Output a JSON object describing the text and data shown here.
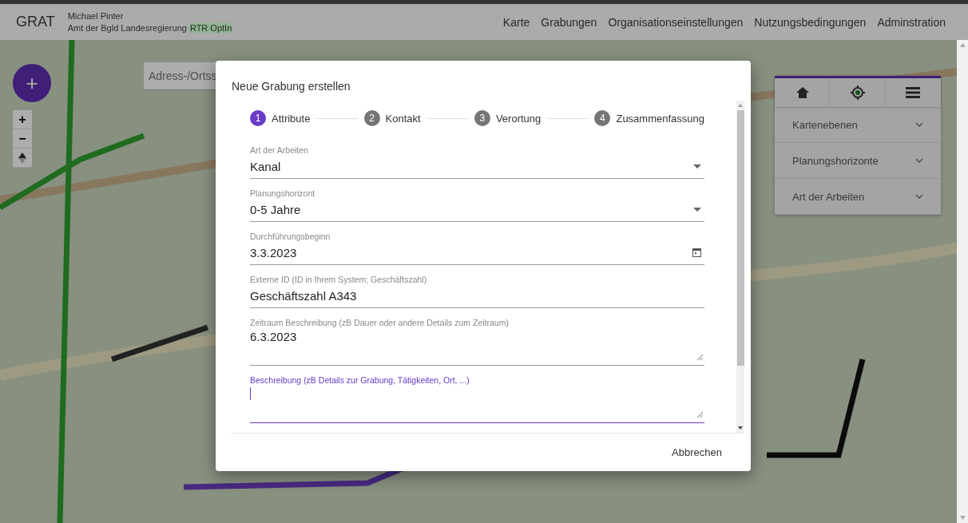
{
  "header": {
    "app_name": "GRAT",
    "user_name": "Michael Pinter",
    "organisation": "Amt der Bgld Landesregierung",
    "badge": "RTR OptIn",
    "nav": [
      {
        "label": "Karte"
      },
      {
        "label": "Grabungen"
      },
      {
        "label": "Organisationseinstellungen"
      },
      {
        "label": "Nutzungsbedingungen"
      },
      {
        "label": "Adminstration"
      }
    ]
  },
  "map": {
    "add_button": "+",
    "zoom_in": "+",
    "zoom_out": "−",
    "search": {
      "placeholder": "Adress-/Ortss"
    },
    "panel": {
      "tabs": [
        {
          "kind": "home",
          "selected": false
        },
        {
          "kind": "locate",
          "selected": false
        },
        {
          "kind": "list",
          "selected": false
        }
      ],
      "sections": [
        {
          "label": "Kartenebenen",
          "expanded": false
        },
        {
          "label": "Planungshorizonte",
          "expanded": false
        },
        {
          "label": "Art der Arbeiten",
          "expanded": false
        }
      ]
    }
  },
  "dialog": {
    "title": "Neue Grabung erstellen",
    "steps": [
      {
        "number": "1",
        "label": "Attribute",
        "selected": true
      },
      {
        "number": "2",
        "label": "Kontakt",
        "selected": false
      },
      {
        "number": "3",
        "label": "Verortung",
        "selected": false
      },
      {
        "number": "4",
        "label": "Zusammenfassung",
        "selected": false
      }
    ],
    "fields": [
      {
        "kind": "select",
        "label": "Art der Arbeiten",
        "value": "Kanal",
        "focused": false
      },
      {
        "kind": "select",
        "label": "Planungshorizont",
        "value": "0-5 Jahre",
        "focused": false
      },
      {
        "kind": "date",
        "label": "Durchführungsbeginn",
        "value": "3.3.2023",
        "focused": false
      },
      {
        "kind": "text",
        "label": "Externe ID (ID in Ihrem System; Geschäftszahl)",
        "value": "Geschäftszahl A343",
        "focused": false
      },
      {
        "kind": "textarea",
        "label": "Zeitraum Beschreibung (zB Dauer oder andere Details zum Zeitraum)",
        "value": "6.3.2023",
        "focused": false
      },
      {
        "kind": "textarea",
        "label": "Beschreibung (zB Details zur Grabung, Tätigkeiten, Ort, ...)",
        "focused": true
      }
    ],
    "cancel_button": "Abbrechen"
  }
}
